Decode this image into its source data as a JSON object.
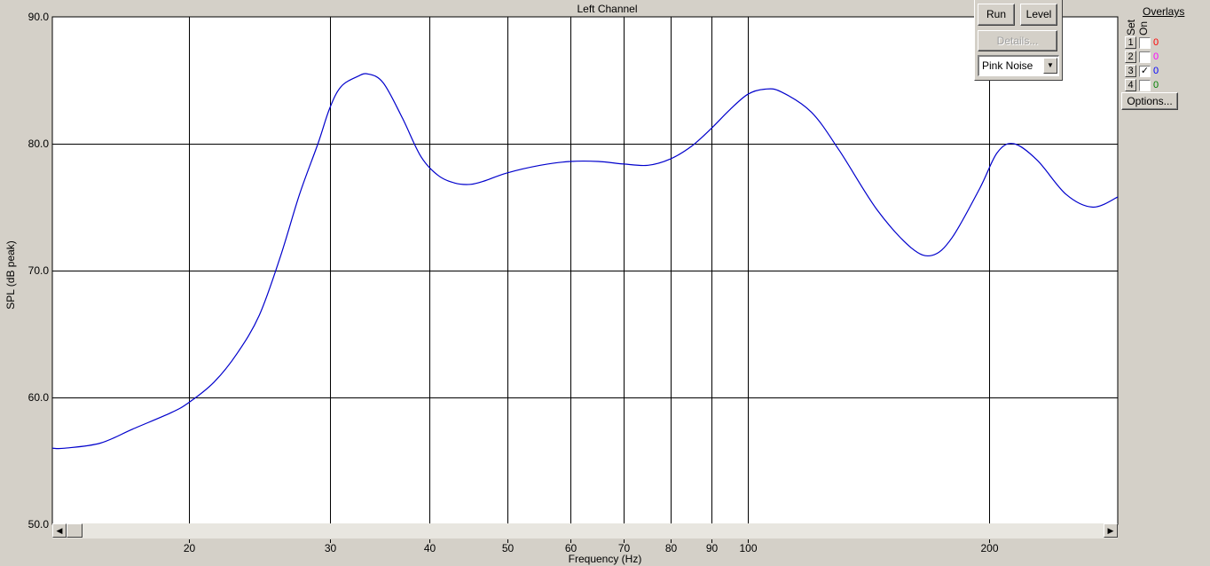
{
  "chart_data": {
    "type": "line",
    "title": "Left Channel",
    "xlabel": "Frequency (Hz)",
    "ylabel": "SPL (dB peak)",
    "xscale": "log",
    "xlim": [
      13.5,
      290
    ],
    "ylim": [
      50,
      90
    ],
    "xticks": [
      20,
      30,
      40,
      50,
      60,
      70,
      80,
      90,
      100,
      200
    ],
    "yticks": [
      50,
      60,
      70,
      80,
      90
    ],
    "ytick_labels": [
      "50.0",
      "60.0",
      "70.0",
      "80.0",
      "90.0"
    ],
    "grid": true,
    "series": [
      {
        "color": "#0000cc",
        "x": [
          13.5,
          14.0,
          15.5,
          17.0,
          19.0,
          20.0,
          21.5,
          23.0,
          24.5,
          26.0,
          27.5,
          29.0,
          30.0,
          31.0,
          32.5,
          33.5,
          35.0,
          37.0,
          39.0,
          41.0,
          43.0,
          45.0,
          47.0,
          50.0,
          55.0,
          60.0,
          65.0,
          70.0,
          75.0,
          80.0,
          85.0,
          90.0,
          95.0,
          100.0,
          105.0,
          110.0,
          120.0,
          130.0,
          145.0,
          160.0,
          170.0,
          180.0,
          195.0,
          205.0,
          215.0,
          230.0,
          250.0,
          270.0,
          290.0
        ],
        "y": [
          56.0,
          56.0,
          56.4,
          57.5,
          58.8,
          59.6,
          61.2,
          63.5,
          66.5,
          71.0,
          76.0,
          80.0,
          82.8,
          84.5,
          85.3,
          85.5,
          84.8,
          82.0,
          79.0,
          77.5,
          76.9,
          76.8,
          77.1,
          77.7,
          78.3,
          78.6,
          78.6,
          78.4,
          78.3,
          78.8,
          79.8,
          81.2,
          82.7,
          83.9,
          84.3,
          84.1,
          82.5,
          79.5,
          74.8,
          71.8,
          71.2,
          72.6,
          76.5,
          79.3,
          80.0,
          78.7,
          76.0,
          75.0,
          75.8
        ]
      }
    ]
  },
  "controls": {
    "run_label": "Run",
    "level_label": "Level",
    "details_label": "Details...",
    "signal_value": "Pink Noise"
  },
  "overlays": {
    "title": "Overlays",
    "set_label": "Set",
    "on_label": "On",
    "rows": [
      {
        "set": "1",
        "checked": false,
        "value": "0",
        "color": "#ff0000"
      },
      {
        "set": "2",
        "checked": false,
        "value": "0",
        "color": "#ff00ff"
      },
      {
        "set": "3",
        "checked": true,
        "value": "0",
        "color": "#0000ff"
      },
      {
        "set": "4",
        "checked": false,
        "value": "0",
        "color": "#008000"
      }
    ],
    "options_label": "Options..."
  }
}
